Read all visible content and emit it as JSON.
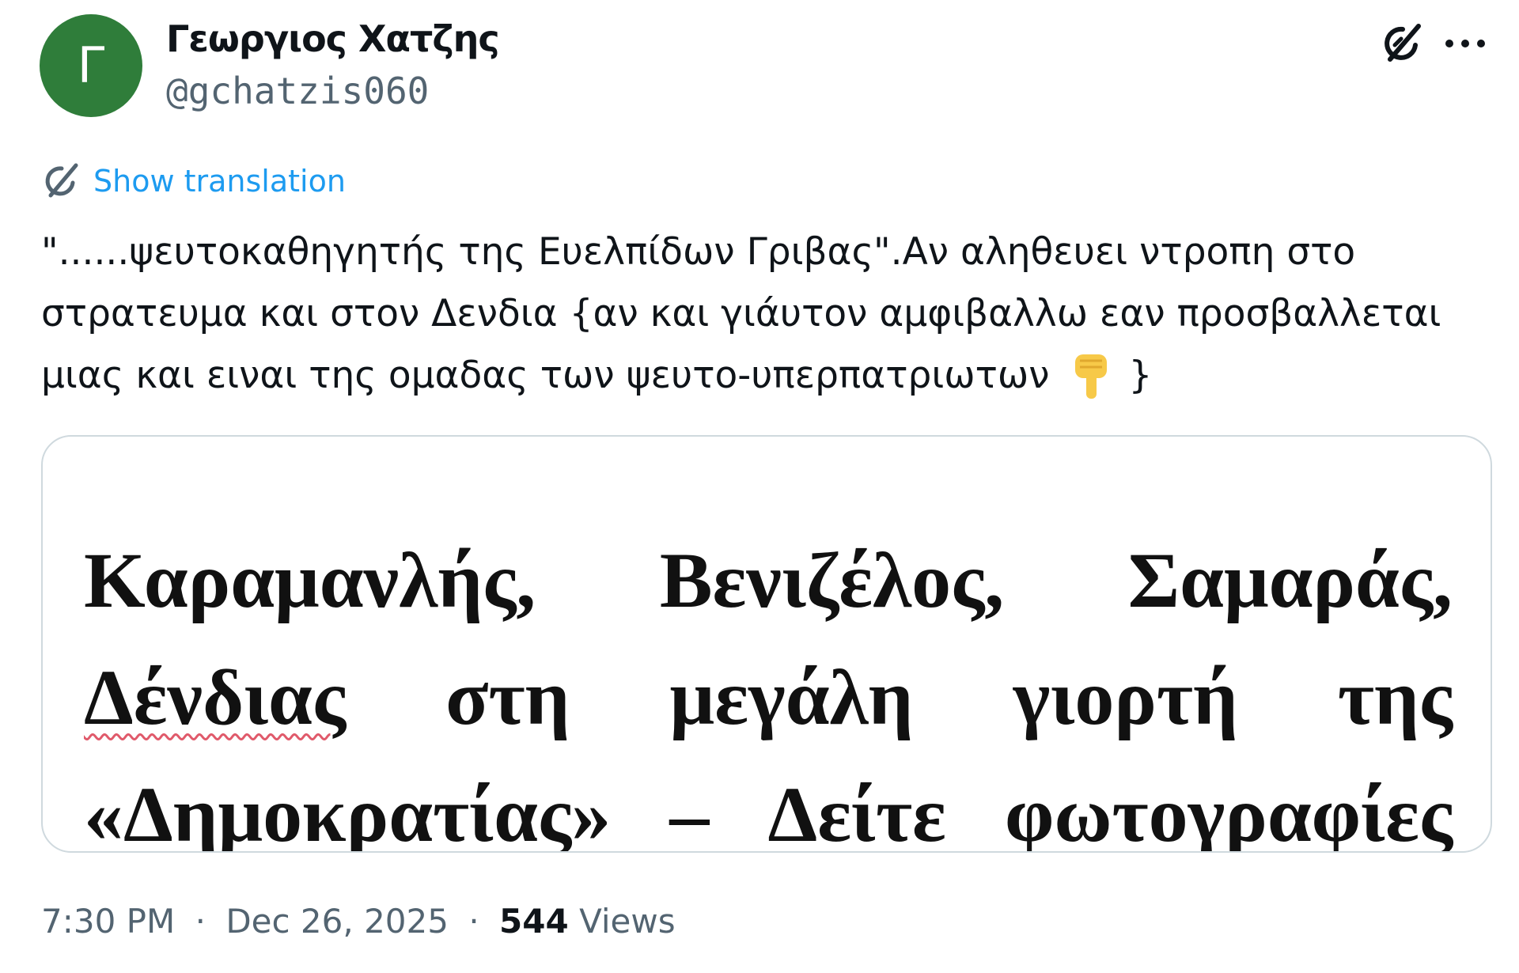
{
  "author": {
    "avatar_letter": "Γ",
    "avatar_color": "#2f7d3a",
    "display_name": "Γεωργιος Χατζης",
    "handle": "@gchatzis060"
  },
  "actions": {
    "grok_icon": "grok-slash-icon",
    "more_icon": "ellipsis-icon"
  },
  "translation": {
    "label": "Show translation",
    "icon": "translate-icon",
    "color": "#1d9bf0"
  },
  "tweet": {
    "lines": [
      "\"......ψευτοκαθηγητής της Ευελπίδων Γριβας\".Αν αληθευει ντροπη στο",
      "στρατευμα και στον Δενδια {αν και γιάυτον αμφιβαλλω εαν προσβαλλεται",
      "μιας και ειναι της ομαδας των ψευτο-υπερπατριωτων"
    ],
    "line3_end": "}",
    "emoji": "point-down-emoji"
  },
  "card": {
    "headline_lines": [
      [
        "Καραμανλής,",
        "Βενιζέλος,",
        "Σαμαράς,"
      ],
      [
        "Δένδιας",
        "στη",
        "μεγάλη",
        "γιορτή",
        "της"
      ],
      [
        "«Δημοκρατίας»",
        "–",
        "Δείτε",
        "φωτογραφίες"
      ]
    ]
  },
  "meta": {
    "time": "7:30 PM",
    "dot1": "·",
    "date": "Dec 26, 2025",
    "dot2": "·",
    "views_count": "544",
    "views_label": "Views"
  },
  "colors": {
    "text": "#0f1419",
    "secondary": "#536471",
    "border": "#cfd9de"
  }
}
